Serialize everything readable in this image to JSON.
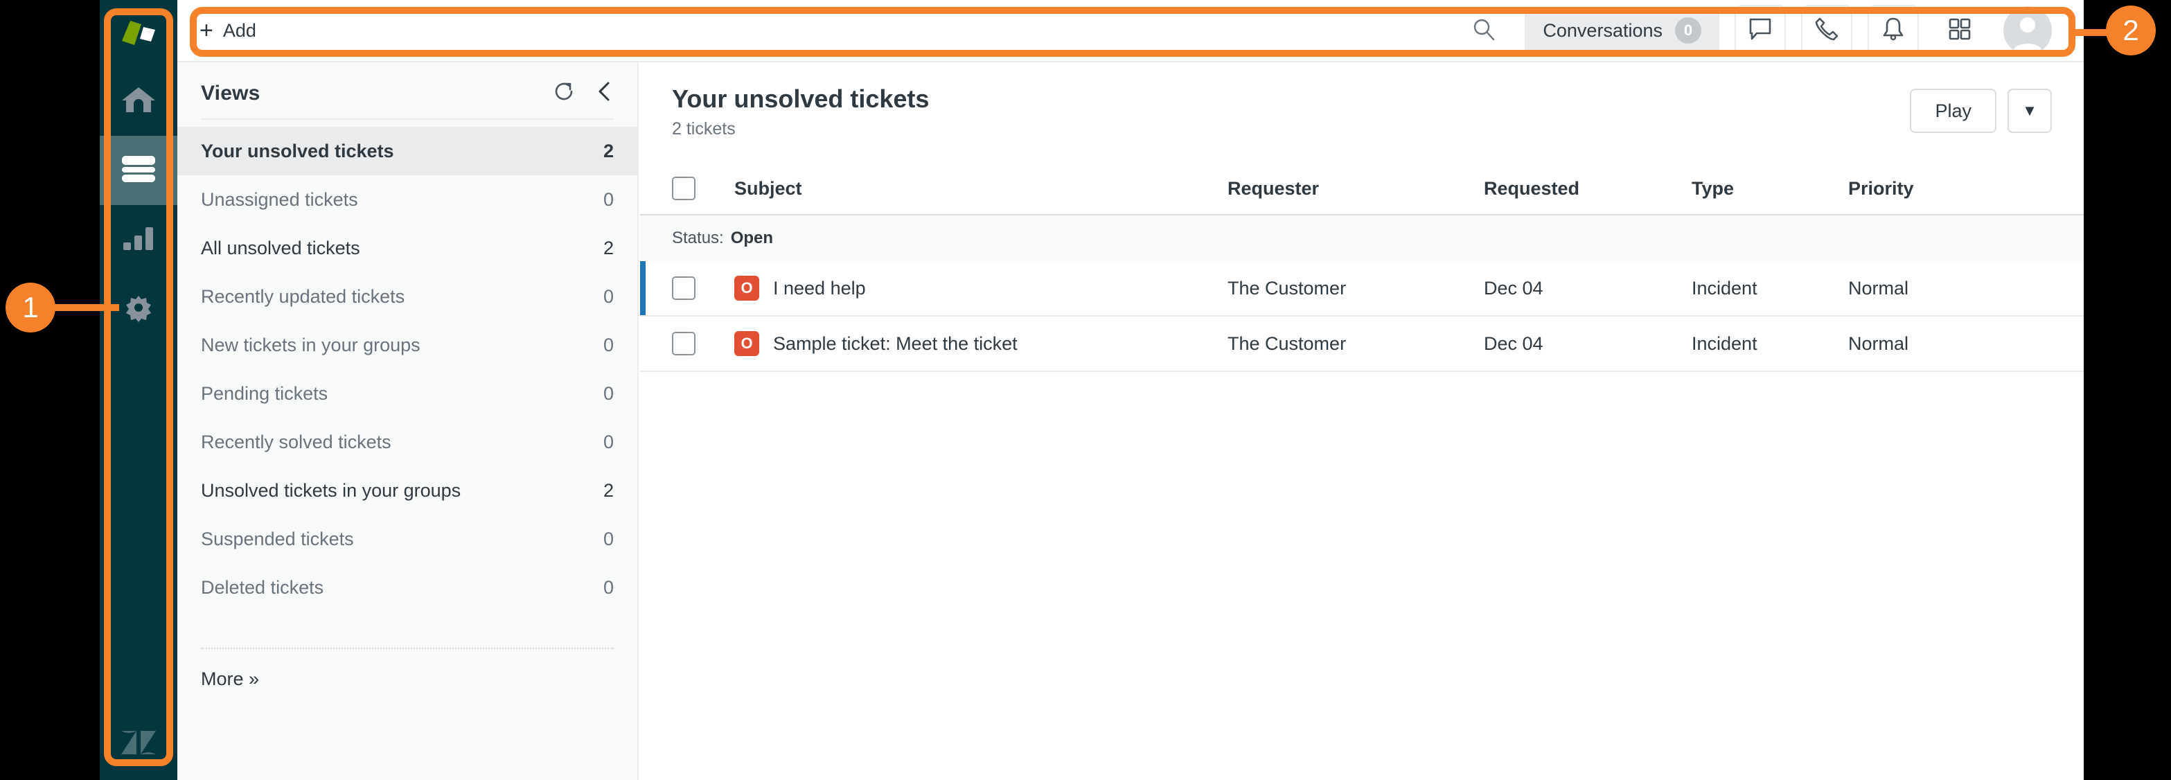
{
  "rail": {
    "logo_icon": "zendesk-product-logo",
    "items": [
      {
        "icon": "home-icon",
        "name": "home",
        "active": false
      },
      {
        "icon": "tickets-icon",
        "name": "tickets",
        "active": true
      },
      {
        "icon": "reporting-bar-chart-icon",
        "name": "reporting",
        "active": false
      },
      {
        "icon": "gear-icon",
        "name": "admin",
        "active": false
      }
    ],
    "bottom_icon": "zendesk-z-logo"
  },
  "topbar": {
    "add_label": "Add",
    "add_plus": "+",
    "search_icon": "search-icon",
    "conversations_label": "Conversations",
    "conversations_count": "0",
    "icons": [
      {
        "name": "chat-icon",
        "boxed": true
      },
      {
        "name": "phone-icon",
        "boxed": true
      },
      {
        "name": "bell-icon",
        "boxed": true
      },
      {
        "name": "apps-grid-icon",
        "boxed": false
      }
    ],
    "avatar_name": "user-avatar"
  },
  "views": {
    "title": "Views",
    "refresh_icon": "refresh-icon",
    "collapse_icon": "chevron-left-icon",
    "items": [
      {
        "label": "Your unsolved tickets",
        "count": "2",
        "selected": true
      },
      {
        "label": "Unassigned tickets",
        "count": "0",
        "selected": false
      },
      {
        "label": "All unsolved tickets",
        "count": "2",
        "selected": false
      },
      {
        "label": "Recently updated tickets",
        "count": "0",
        "selected": false
      },
      {
        "label": "New tickets in your groups",
        "count": "0",
        "selected": false
      },
      {
        "label": "Pending tickets",
        "count": "0",
        "selected": false
      },
      {
        "label": "Recently solved tickets",
        "count": "0",
        "selected": false
      },
      {
        "label": "Unsolved tickets in your groups",
        "count": "2",
        "selected": false
      },
      {
        "label": "Suspended tickets",
        "count": "0",
        "selected": false
      },
      {
        "label": "Deleted tickets",
        "count": "0",
        "selected": false
      }
    ],
    "more_label": "More »"
  },
  "main": {
    "title": "Your unsolved tickets",
    "subtitle": "2 tickets",
    "play_label": "Play",
    "caret_glyph": "▼",
    "table": {
      "headers": [
        "Subject",
        "Requester",
        "Requested",
        "Type",
        "Priority"
      ],
      "group_prefix": "Status:",
      "group_value": "Open",
      "rows": [
        {
          "status_badge": "O",
          "subject": "I need help",
          "requester": "The Customer",
          "requested": "Dec 04",
          "type": "Incident",
          "priority": "Normal",
          "unread": true
        },
        {
          "status_badge": "O",
          "subject": "Sample ticket: Meet the ticket",
          "requester": "The Customer",
          "requested": "Dec 04",
          "type": "Incident",
          "priority": "Normal",
          "unread": false
        }
      ]
    }
  },
  "annotations": [
    {
      "number": "1",
      "target": "left-icon-rail"
    },
    {
      "number": "2",
      "target": "top-toolbar"
    }
  ],
  "colors": {
    "rail_bg": "#03363D",
    "rail_active": "#4A6E74",
    "annotation": "#F5822A",
    "status_open": "#E34F32",
    "unread_marker": "#1F73B7",
    "panel_bg": "#F8F9F9"
  }
}
